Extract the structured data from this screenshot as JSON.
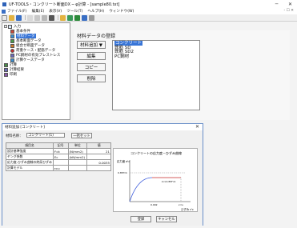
{
  "window": {
    "title": "UF-TOOLS・コンクリート断面DX ─ φ計算 - [sample80.txt]",
    "minimize": "─",
    "close": "✕"
  },
  "menubar": {
    "items": [
      "ファイル(F)",
      "編集(E)",
      "表示(V)",
      "ツール(T)",
      "ヘルプ(H)",
      "ウィンドウ(W)"
    ],
    "mdi_controls": "- ☐ ✕"
  },
  "tree": {
    "items": [
      {
        "label": "入力",
        "level": 0,
        "expander": "−"
      },
      {
        "label": "基本条件",
        "level": 1,
        "color": "#c94a3a"
      },
      {
        "label": "材料データ",
        "level": 1,
        "color": "#3a8fd1",
        "selected": true
      },
      {
        "label": "基本断面データ",
        "level": 1,
        "color": "#4a9a4a"
      },
      {
        "label": "組合せ断面データ",
        "level": 1,
        "color": "#c97a2a"
      },
      {
        "label": "荷重ケース・配筋データ",
        "level": 1,
        "color": "#c92a2a"
      },
      {
        "label": "PC鋼材の有効プレストレス",
        "level": 1,
        "color": "#6a6ab8"
      },
      {
        "label": "計算ケースデータ",
        "level": 1,
        "color": "#3a8fd1"
      },
      {
        "label": "計算",
        "level": 0,
        "color": "#4a8a4a"
      },
      {
        "label": "計算結果",
        "level": 0,
        "color": "#6a6ab8"
      },
      {
        "label": "印刷",
        "level": 0,
        "color": "#8a5aa8"
      }
    ]
  },
  "material_panel": {
    "title": "材料データの登録",
    "add_button": "材料追加 ▼",
    "edit_button": "編集",
    "copy_button": "コピー",
    "delete_button": "削除",
    "list": [
      {
        "label": "コンクリート",
        "selected": true
      },
      {
        "label": "鉄筋 SD"
      },
      {
        "label": "鉄筋 SD2"
      },
      {
        "label": "PC鋼材"
      }
    ]
  },
  "dialog": {
    "title": "材料追加 [コンクリート]",
    "close": "✕",
    "name_label": "材料名称：",
    "name_value": "コンクリート(1)",
    "set_button": "一括セット",
    "table": {
      "headers": [
        "項目名",
        "記号",
        "単位",
        "値"
      ],
      "rows": [
        [
          "設計基準強度",
          "f'ck",
          "(N/mm2)",
          "21"
        ],
        [
          "ヤング係数",
          "Ec",
          "(kN/mm2)",
          ""
        ],
        [
          "応力度-ひずみ曲線の終局ひずみ",
          "",
          "",
          "0.0035"
        ],
        [
          "計算モデル",
          "εcu",
          "",
          ""
        ]
      ]
    },
    "graph": {
      "title": "コンクリートの応力度－ひずみ曲線",
      "y_label": "応力度 σ'c",
      "x_label": "ひずみ ε'c",
      "y_tick": "0.85f'ck",
      "peak_label": "k₁×0.85f'ck",
      "x_tick1": "0.002",
      "x_tick2": "ε'cu"
    },
    "ok_button": "登録",
    "cancel_button": "キャンセル"
  },
  "colors": {
    "selection": "#3875d7",
    "dialog_border": "#6a8fc9",
    "curve": "#3b5bdb",
    "plateau": "#c92a2a"
  }
}
